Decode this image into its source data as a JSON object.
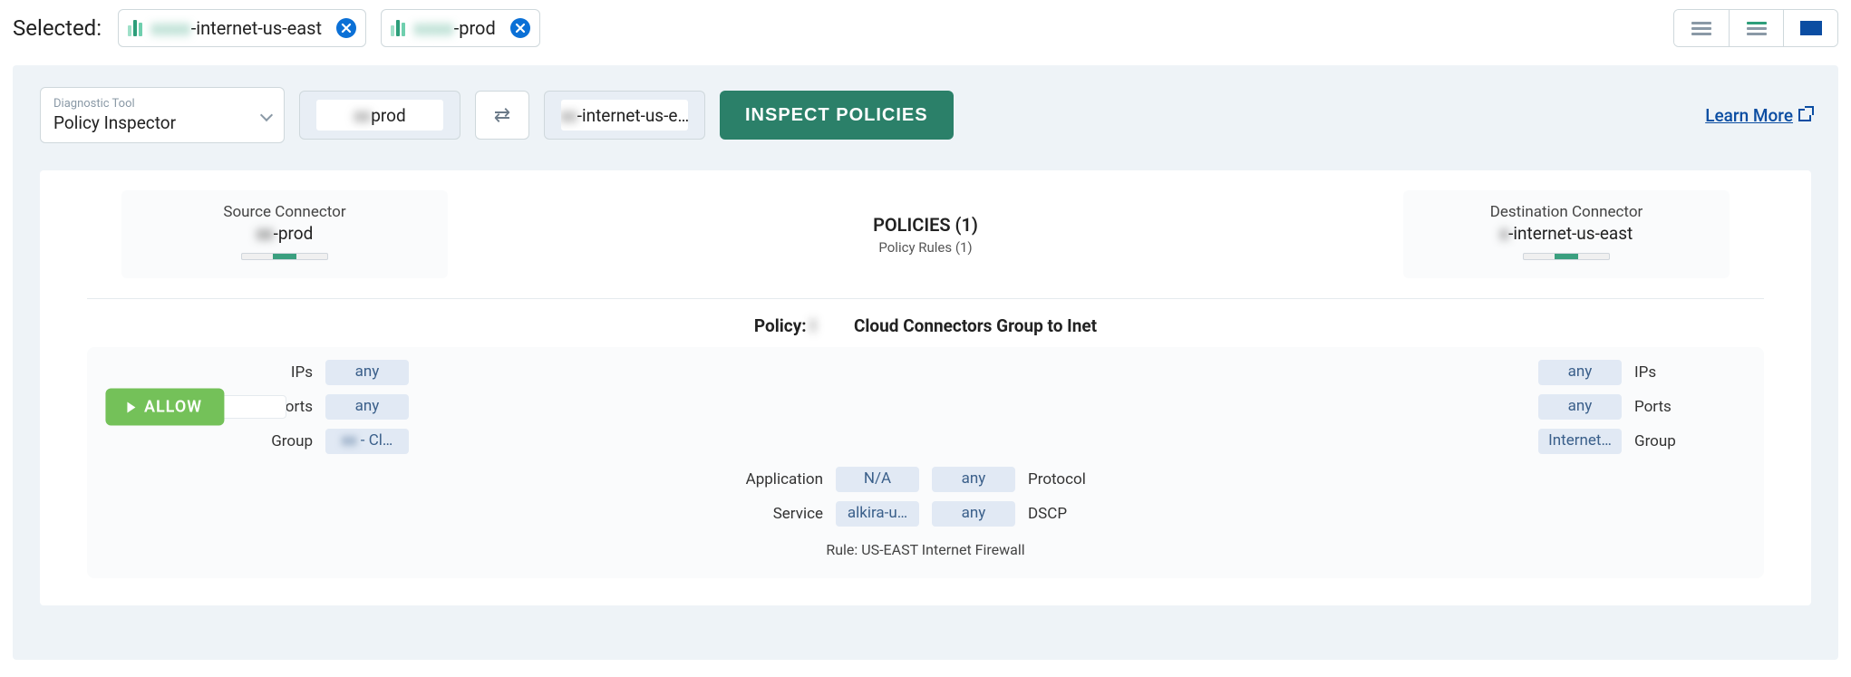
{
  "header": {
    "selected_label": "Selected:",
    "chips": [
      {
        "text_prefix": "xxxx",
        "text_main": "-internet-us-east"
      },
      {
        "text_prefix": "xxxx",
        "text_main": "-prod"
      }
    ]
  },
  "toolbar": {
    "diagnostic_label": "Diagnostic Tool",
    "diagnostic_value": "Policy Inspector",
    "source_box": {
      "prefix": "xx",
      "text": "prod"
    },
    "dest_box": {
      "prefix": "xx",
      "text": "-internet-us-e…"
    },
    "inspect_label": "INSPECT POLICIES",
    "learn_more": "Learn More"
  },
  "summary": {
    "src_title": "Source Connector",
    "src_name_prefix": "xx",
    "src_name": "-prod",
    "policies_title": "POLICIES (1)",
    "policies_sub": "Policy Rules (1)",
    "dst_title": "Destination Connector",
    "dst_name_prefix": "x",
    "dst_name": "-internet-us-east"
  },
  "policy_line": {
    "label": "Policy:",
    "mid_blur": "I",
    "tail": "Cloud Connectors Group to Inet"
  },
  "rule": {
    "left": {
      "ips_label": "IPs",
      "ips_val": "any",
      "ports_label": "Ports",
      "ports_val": "any",
      "group_label": "Group",
      "group_prefix": "xx",
      "group_val": " - Cl…"
    },
    "right": {
      "ips_label": "IPs",
      "ips_val": "any",
      "ports_label": "Ports",
      "ports_val": "any",
      "group_label": "Group",
      "group_val": "Internet…"
    },
    "allow_label": "ALLOW",
    "meta": {
      "app_label": "Application",
      "app_val": "N/A",
      "svc_label": "Service",
      "svc_val": "alkira-u…",
      "proto_label": "Protocol",
      "proto_val": "any",
      "dscp_label": "DSCP",
      "dscp_val": "any"
    },
    "foot": "Rule: US-EAST Internet Firewall"
  }
}
